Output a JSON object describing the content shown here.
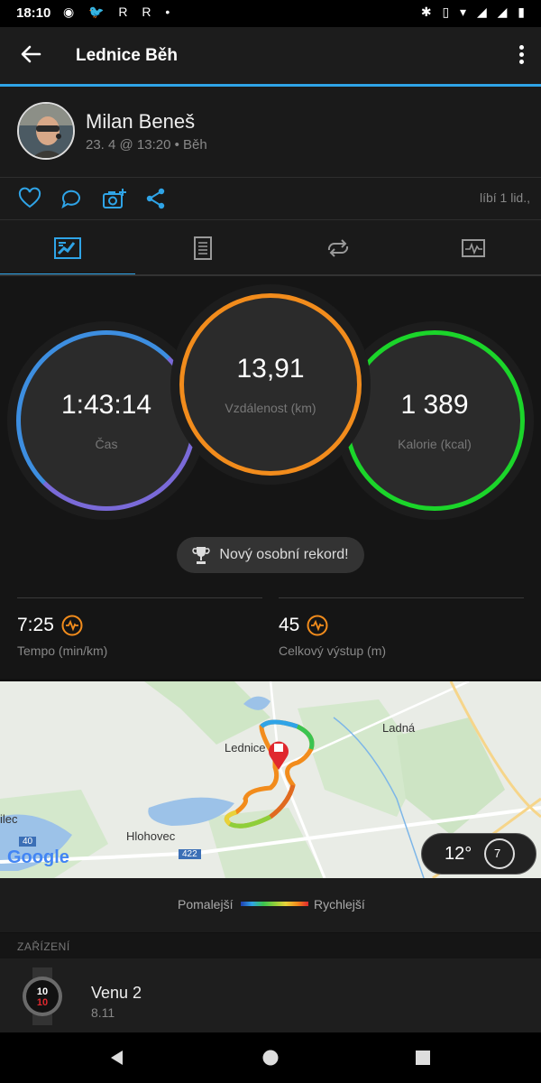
{
  "status_bar": {
    "time": "18:10",
    "left_icons": "◉ 🐦 R R •",
    "right_icons": "✱ ▯ ▾ ◢ ◢ ▮"
  },
  "app_bar": {
    "title": "Lednice Běh"
  },
  "profile": {
    "name": "Milan Beneš",
    "meta": "23. 4 @ 13:20 • Běh"
  },
  "actions": {
    "likes": "líbí 1 lid.,"
  },
  "tabs": [
    {
      "icon": "chart-icon",
      "active": true
    },
    {
      "icon": "list-icon"
    },
    {
      "icon": "laps-icon"
    },
    {
      "icon": "graph-icon"
    }
  ],
  "stats": {
    "time": {
      "value": "1:43:14",
      "label": "Čas"
    },
    "distance": {
      "value": "13,91",
      "label": "Vzdálenost (km)"
    },
    "calories": {
      "value": "1 389",
      "label": "Kalorie (kcal)"
    },
    "record": "Nový osobní rekord!",
    "tempo": {
      "value": "7:25",
      "label": "Tempo (min/km)"
    },
    "ascent": {
      "value": "45",
      "label": "Celkový výstup (m)"
    }
  },
  "map": {
    "places": {
      "lednice": "Lednice",
      "ladna": "Ladná",
      "hlohovec": "Hlohovec",
      "lec": "ilec"
    },
    "roads": {
      "r40": "40",
      "r422": "422"
    },
    "google": "Google",
    "weather": {
      "temp": "12°",
      "wind": "7"
    }
  },
  "legend": {
    "slower": "Pomalejší",
    "faster": "Rychlejší"
  },
  "devices": {
    "header": "ZAŘÍZENÍ",
    "name": "Venu 2",
    "version": "8.11"
  },
  "colors": {
    "accent": "#2fa4e7",
    "time_ring": "#3d7fd9",
    "distance_ring": "#f28c1c",
    "calories_ring": "#1bd52a"
  }
}
